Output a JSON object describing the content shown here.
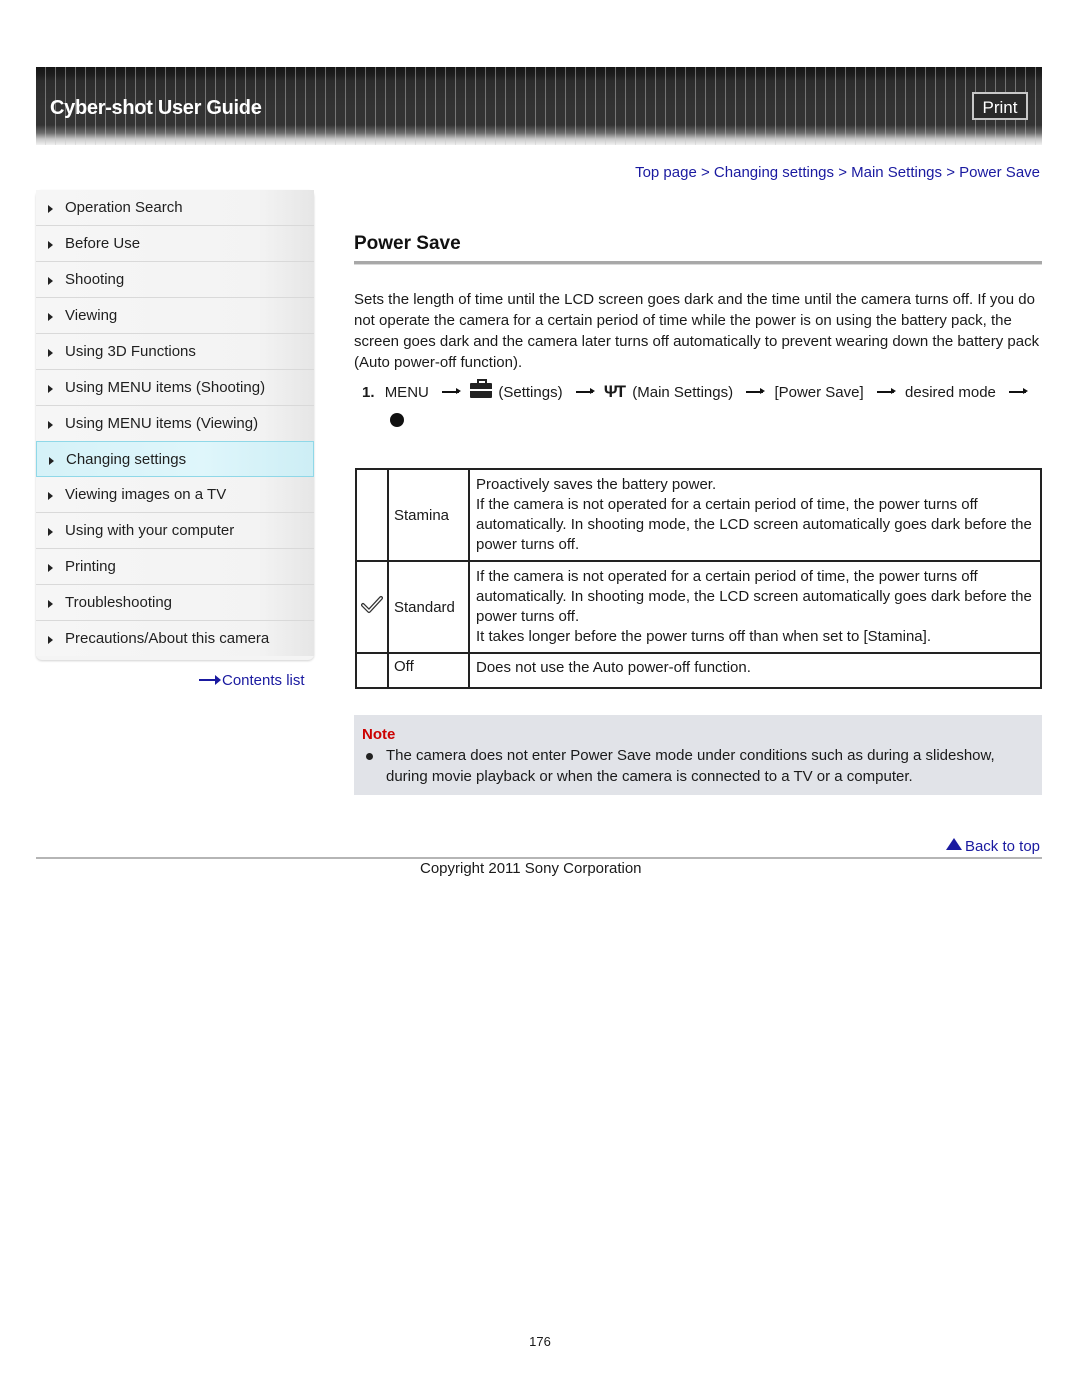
{
  "header": {
    "title": "Cyber-shot User Guide",
    "print_label": "Print"
  },
  "breadcrumb": {
    "items": [
      "Top page",
      "Changing settings",
      "Main Settings",
      "Power Save"
    ],
    "separator": ">"
  },
  "sidebar": {
    "items": [
      {
        "label": "Operation Search",
        "active": false
      },
      {
        "label": "Before Use",
        "active": false
      },
      {
        "label": "Shooting",
        "active": false
      },
      {
        "label": "Viewing",
        "active": false
      },
      {
        "label": "Using 3D Functions",
        "active": false
      },
      {
        "label": "Using MENU items (Shooting)",
        "active": false
      },
      {
        "label": "Using MENU items (Viewing)",
        "active": false
      },
      {
        "label": "Changing settings",
        "active": true
      },
      {
        "label": "Viewing images on a TV",
        "active": false
      },
      {
        "label": "Using with your computer",
        "active": false
      },
      {
        "label": "Printing",
        "active": false
      },
      {
        "label": "Troubleshooting",
        "active": false
      },
      {
        "label": "Precautions/About this camera",
        "active": false
      }
    ],
    "contents_link": "Contents list",
    "active_color": "#d5f2f8"
  },
  "main": {
    "title": "Power Save",
    "intro": "Sets the length of time until the LCD screen goes dark and the time until the camera turns off. If you do not operate the camera for a certain period of time while the power is on using the battery pack, the screen goes dark and the camera later turns off automatically to prevent wearing down the battery pack (Auto power-off function).",
    "step": {
      "number": "1.",
      "parts": {
        "menu": "MENU",
        "settings_icon": "toolbox-icon",
        "settings": "(Settings)",
        "main_settings_icon": "tools-icon",
        "main_settings": "(Main Settings)",
        "power_save": "[Power Save]",
        "desired_mode": "desired mode",
        "final_icon": "center-button-dot-icon"
      }
    },
    "modes": [
      {
        "icon": "",
        "name": "Stamina",
        "description": [
          "Proactively saves the battery power.",
          "If the camera is not operated for a certain period of time, the power turns off automatically. In shooting mode, the LCD screen automatically goes dark before the power turns off."
        ]
      },
      {
        "icon": "checkmark-icon",
        "name": "Standard",
        "description": [
          "If the camera is not operated for a certain period of time, the power turns off automatically. In shooting mode, the LCD screen automatically goes dark before the power turns off.",
          "It takes longer before the power turns off than when set to [Stamina]."
        ]
      },
      {
        "icon": "",
        "name": "Off",
        "description": [
          "Does not use the Auto power-off function."
        ]
      }
    ],
    "note": {
      "label": "Note",
      "items": [
        "The camera does not enter Power Save mode under conditions such as during a slideshow, during movie playback or when the camera is connected to a TV or a computer."
      ],
      "label_color": "#cc0000",
      "background": "#e1e3e8"
    }
  },
  "footer": {
    "back_to_top": "Back to top",
    "copyright": "Copyright 2011 Sony Corporation",
    "page_number": "176"
  },
  "colors": {
    "link": "#1a1aa0",
    "banner": "#333333"
  }
}
